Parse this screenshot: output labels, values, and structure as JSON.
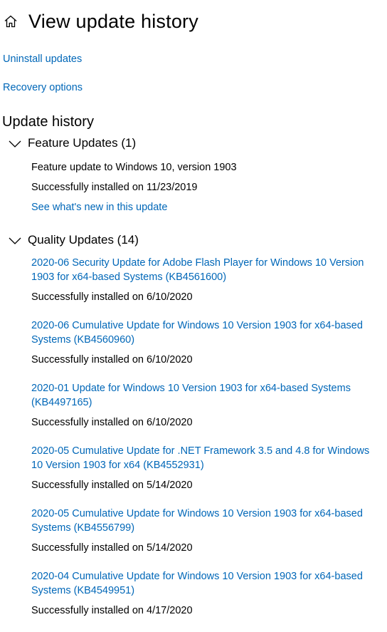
{
  "header": {
    "title": "View update history"
  },
  "links": {
    "uninstall": "Uninstall updates",
    "recovery": "Recovery options"
  },
  "section": {
    "heading": "Update history"
  },
  "feature_updates": {
    "title": "Feature Updates (1)",
    "entries": [
      {
        "title": "Feature update to Windows 10, version 1903",
        "status": "Successfully installed on 11/23/2019",
        "link": "See what's new in this update"
      }
    ]
  },
  "quality_updates": {
    "title": "Quality Updates (14)",
    "entries": [
      {
        "title": "2020-06 Security Update for Adobe Flash Player for Windows 10 Version 1903 for x64-based Systems (KB4561600)",
        "status": "Successfully installed on 6/10/2020"
      },
      {
        "title": "2020-06 Cumulative Update for Windows 10 Version 1903 for x64-based Systems (KB4560960)",
        "status": "Successfully installed on 6/10/2020"
      },
      {
        "title": "2020-01 Update for Windows 10 Version 1903 for x64-based Systems (KB4497165)",
        "status": "Successfully installed on 6/10/2020"
      },
      {
        "title": "2020-05 Cumulative Update for .NET Framework 3.5 and 4.8 for Windows 10 Version 1903 for x64 (KB4552931)",
        "status": "Successfully installed on 5/14/2020"
      },
      {
        "title": "2020-05 Cumulative Update for Windows 10 Version 1903 for x64-based Systems (KB4556799)",
        "status": "Successfully installed on 5/14/2020"
      },
      {
        "title": "2020-04 Cumulative Update for Windows 10 Version 1903 for x64-based Systems (KB4549951)",
        "status": "Successfully installed on 4/17/2020"
      }
    ]
  },
  "colors": {
    "link": "#0067b8",
    "text": "#000000",
    "background": "#ffffff"
  },
  "icons": {
    "home": "home-icon",
    "expand": "chevron-down-icon"
  }
}
